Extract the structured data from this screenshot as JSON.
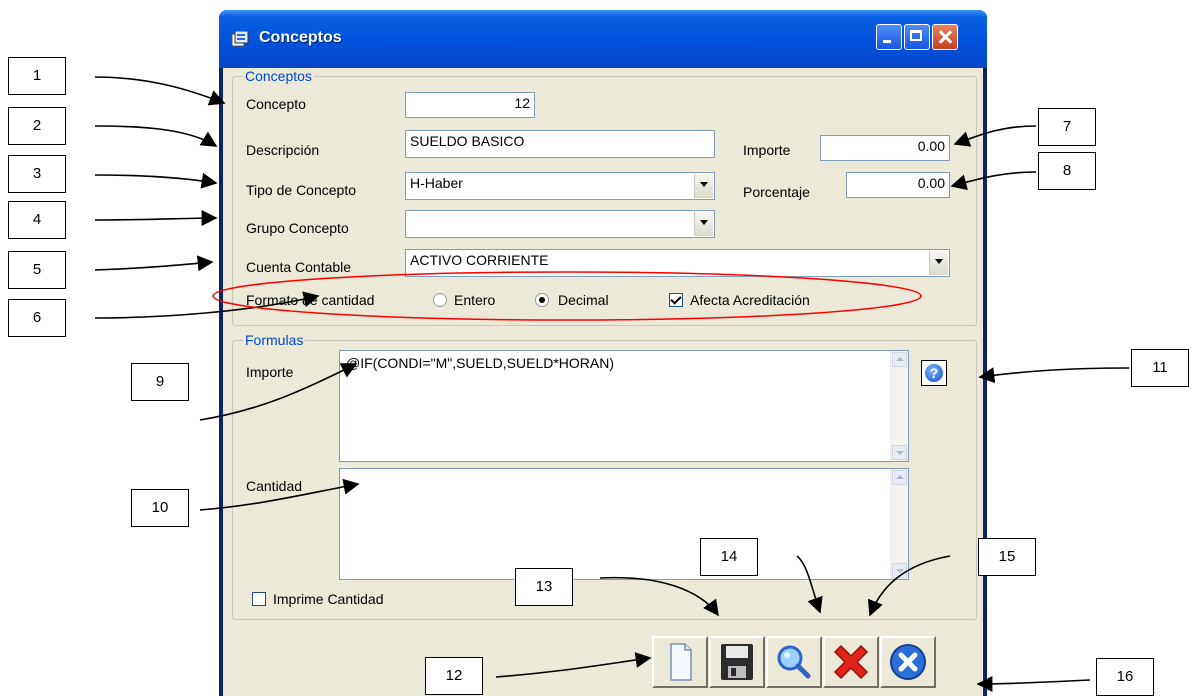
{
  "window": {
    "title": "Conceptos"
  },
  "conceptos_group": {
    "title": "Conceptos",
    "concepto_label": "Concepto",
    "concepto_value": "12",
    "descripcion_label": "Descripción",
    "descripcion_value": "SUELDO BASICO",
    "importe_label": "Importe",
    "importe_value": "0.00",
    "tipo_label": "Tipo de Concepto",
    "tipo_value": "H-Haber",
    "porcentaje_label": "Porcentaje",
    "porcentaje_value": "0.00",
    "grupo_label": "Grupo Concepto",
    "grupo_value": "",
    "cuenta_label": "Cuenta Contable",
    "cuenta_value": "ACTIVO CORRIENTE",
    "formato_label": "Formato de cantidad",
    "entero_label": "Entero",
    "decimal_label": "Decimal",
    "afecta_label": "Afecta Acreditación"
  },
  "formulas_group": {
    "title": "Formulas",
    "importe_label": "Importe",
    "importe_formula": "@IF(CONDI=\"M\",SUELD,SUELD*HORAN)",
    "cantidad_label": "Cantidad",
    "cantidad_formula": "",
    "imprime_label": "Imprime Cantidad",
    "help_glyph": "?"
  },
  "state": {
    "formato_selected": "Decimal",
    "afecta_checked": true,
    "imprime_checked": false
  },
  "toolbar_icons": [
    "new-document-icon",
    "save-disk-icon",
    "search-magnifier-icon",
    "delete-x-icon",
    "exit-icon"
  ],
  "callouts": [
    "1",
    "2",
    "3",
    "4",
    "5",
    "6",
    "7",
    "8",
    "9",
    "10",
    "11",
    "12",
    "13",
    "14",
    "15",
    "16"
  ],
  "colors": {
    "titlebar": "#0052dd",
    "dialog_bg": "#ece9d8",
    "group_title": "#0046d5",
    "highlight_ellipse": "#ff0000"
  }
}
